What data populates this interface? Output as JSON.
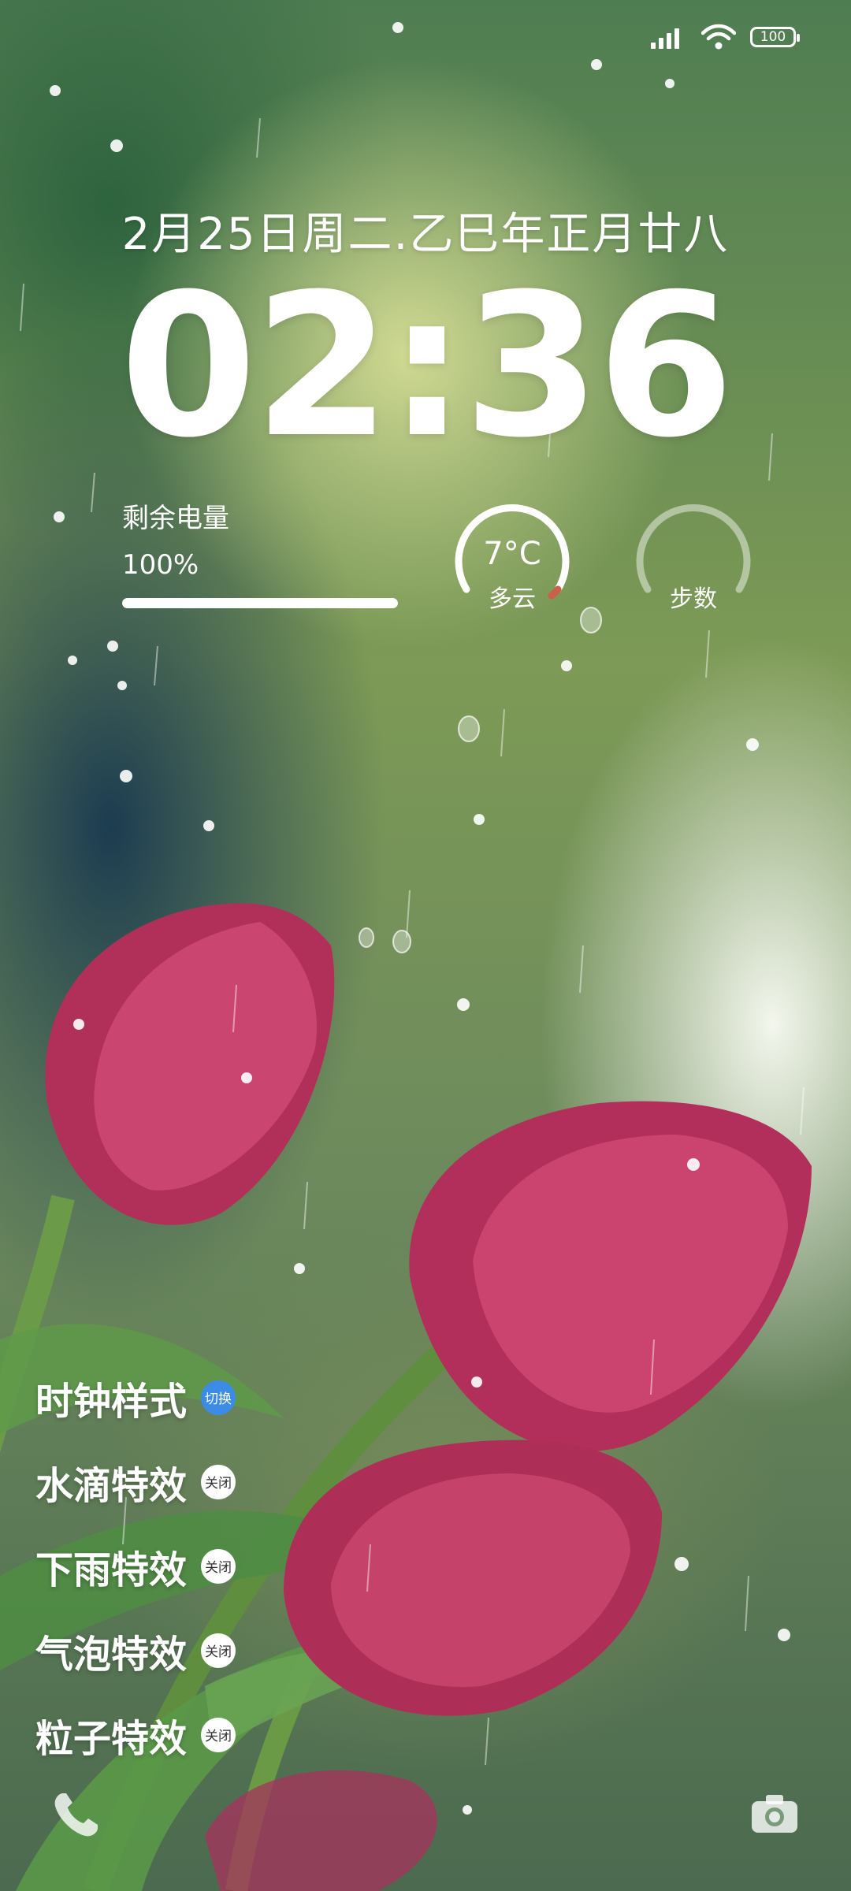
{
  "status_bar": {
    "signal_icon": "signal-bars-icon",
    "wifi_icon": "wifi-icon",
    "battery_percent": "100"
  },
  "lock_screen": {
    "date_text": "2月25日周二.乙巳年正月廿八",
    "time_text": "02:36"
  },
  "battery_widget": {
    "label": "剩余电量",
    "value_text": "100%",
    "level": 1.0
  },
  "weather_widget": {
    "temperature": "7°C",
    "condition": "多云"
  },
  "steps_widget": {
    "label": "步数"
  },
  "effects_menu": {
    "items": [
      {
        "label": "时钟样式",
        "badge": "切换",
        "accent": true
      },
      {
        "label": "水滴特效",
        "badge": "关闭",
        "accent": false
      },
      {
        "label": "下雨特效",
        "badge": "关闭",
        "accent": false
      },
      {
        "label": "气泡特效",
        "badge": "关闭",
        "accent": false
      },
      {
        "label": "粒子特效",
        "badge": "关闭",
        "accent": false
      }
    ]
  },
  "shortcuts": {
    "left_icon": "phone-icon",
    "right_icon": "camera-icon"
  },
  "colors": {
    "accent": "#3c8ce7",
    "text": "#ffffff",
    "tulip": "#b8325a"
  }
}
